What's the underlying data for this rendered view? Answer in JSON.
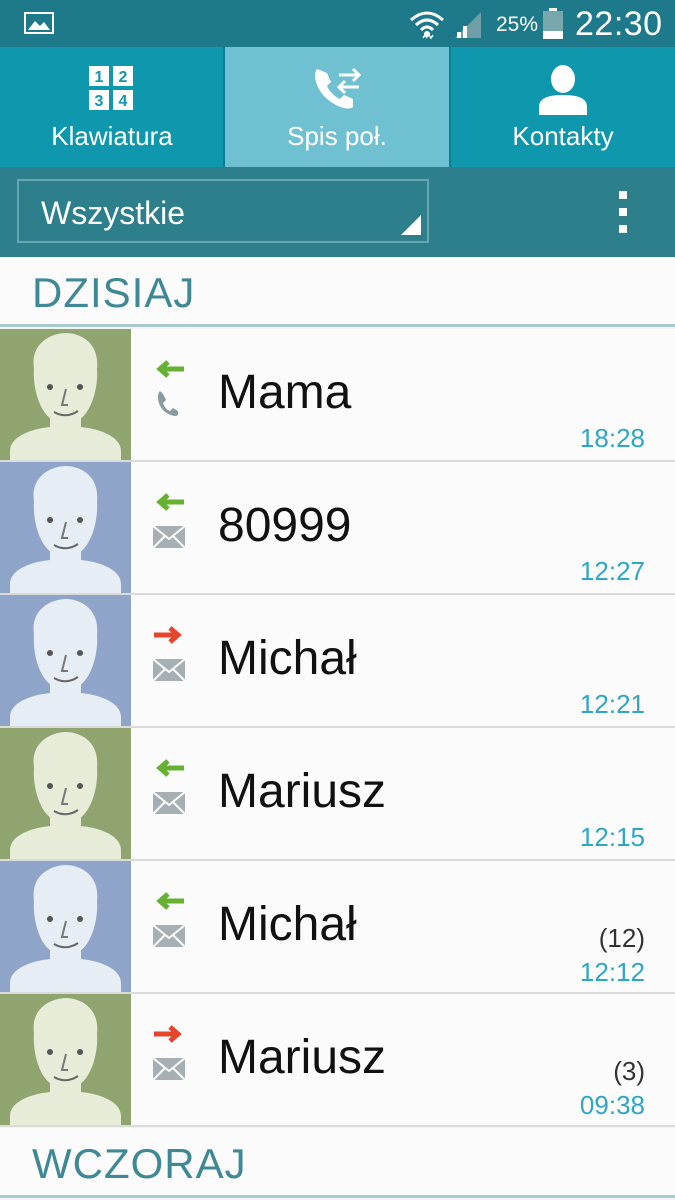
{
  "status_bar": {
    "battery_percent": "25%",
    "time": "22:30"
  },
  "tabs": [
    {
      "label": "Klawiatura",
      "icon": "keypad-icon",
      "selected": false
    },
    {
      "label": "Spis poł.",
      "icon": "call-log-icon",
      "selected": true
    },
    {
      "label": "Kontakty",
      "icon": "contact-icon",
      "selected": false
    }
  ],
  "filter": {
    "value": "Wszystkie"
  },
  "sections": {
    "today": "DZISIAJ",
    "yesterday": "WCZORAJ"
  },
  "entries": [
    {
      "name": "Mama",
      "time": "18:28",
      "count": "",
      "direction": "incoming",
      "type": "call",
      "avatar_bg": "#8fa46e"
    },
    {
      "name": "80999",
      "time": "12:27",
      "count": "",
      "direction": "incoming",
      "type": "message",
      "avatar_bg": "#8ea4c8"
    },
    {
      "name": "Michał",
      "time": "12:21",
      "count": "",
      "direction": "outgoing",
      "type": "message",
      "avatar_bg": "#8ea4c8"
    },
    {
      "name": "Mariusz",
      "time": "12:15",
      "count": "",
      "direction": "incoming",
      "type": "message",
      "avatar_bg": "#8fa46e"
    },
    {
      "name": "Michał",
      "time": "12:12",
      "count": "(12)",
      "direction": "incoming",
      "type": "message",
      "avatar_bg": "#8ea4c8"
    },
    {
      "name": "Mariusz",
      "time": "09:38",
      "count": "(3)",
      "direction": "outgoing",
      "type": "message",
      "avatar_bg": "#8fa46e"
    }
  ],
  "colors": {
    "incoming": "#66b032",
    "outgoing": "#e4452c",
    "accent": "#0f97ad"
  }
}
